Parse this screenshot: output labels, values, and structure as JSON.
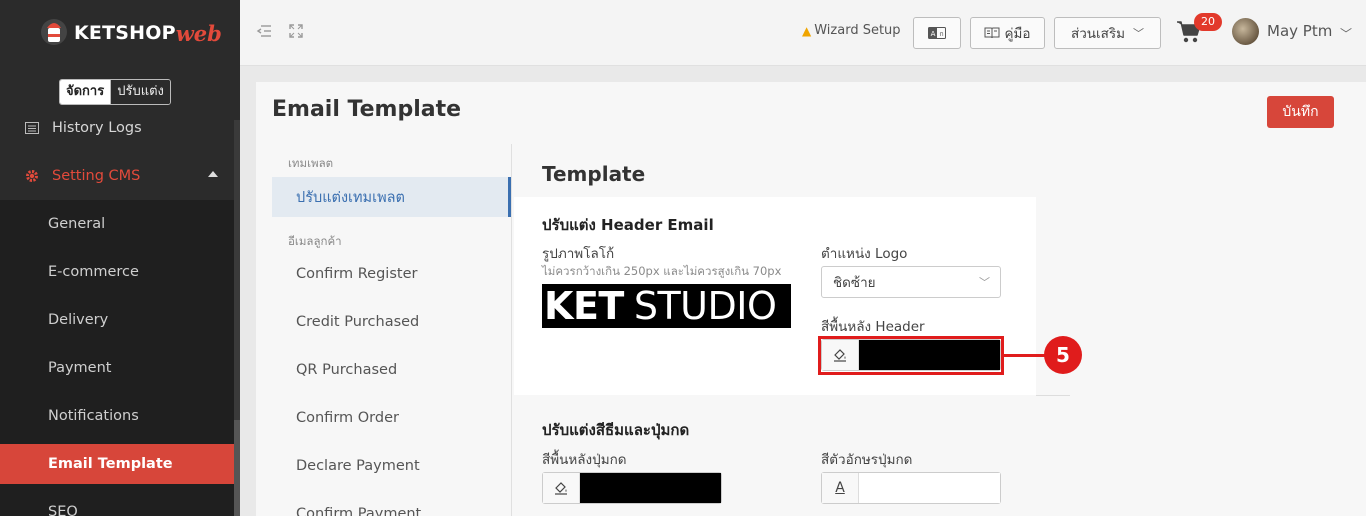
{
  "brand": {
    "name": "KETSHOP",
    "suffix": "web",
    "accent": "#e24a3b"
  },
  "mode_toggle": {
    "active": "จัดการ",
    "inactive": "ปรับแต่ง"
  },
  "sidebar": {
    "history": "History Logs",
    "setting": "Setting CMS",
    "sub_items": [
      {
        "label": "General"
      },
      {
        "label": "E-commerce"
      },
      {
        "label": "Delivery"
      },
      {
        "label": "Payment"
      },
      {
        "label": "Notifications"
      },
      {
        "label": "Email Template"
      },
      {
        "label": "SEO"
      }
    ]
  },
  "topbar": {
    "wizard": "Wizard Setup",
    "manual": "คู่มือ",
    "extras": "ส่วนเสริม",
    "cart_count": "20",
    "user_name": "May Ptm"
  },
  "page": {
    "title": "Email Template",
    "save_label": "บันทึก",
    "section_title": "Template"
  },
  "template_nav": {
    "group1": "เทมเพลต",
    "customize": "ปรับแต่งเทมเพลต",
    "group2": "อีเมลลูกค้า",
    "items": [
      {
        "label": "Confirm Register"
      },
      {
        "label": "Credit Purchased"
      },
      {
        "label": "QR Purchased"
      },
      {
        "label": "Confirm Order"
      },
      {
        "label": "Declare Payment"
      },
      {
        "label": "Confirm Payment"
      }
    ]
  },
  "header_email": {
    "title": "ปรับแต่ง Header Email",
    "logo_label": "รูปภาพโลโก้",
    "logo_hint": "ไม่ควรกว้างเกิน 250px และไม่ควรสูงเกิน 70px",
    "logo_text_bold": "KET",
    "logo_text_light": "STUDIO",
    "position_label": "ตำแหน่ง Logo",
    "position_value": "ชิดซ้าย",
    "bg_label": "สีพื้นหลัง Header",
    "bg_color": "#000000"
  },
  "annotation": {
    "step": "5",
    "color": "#e01c1c"
  },
  "theme": {
    "title": "ปรับแต่งสีธีมและปุ่มกด",
    "button_bg_label": "สีพื้นหลังปุ่มกด",
    "button_bg_color": "#000000",
    "button_text_label": "สีตัวอักษรปุ่มกด",
    "text_icon": "A"
  }
}
